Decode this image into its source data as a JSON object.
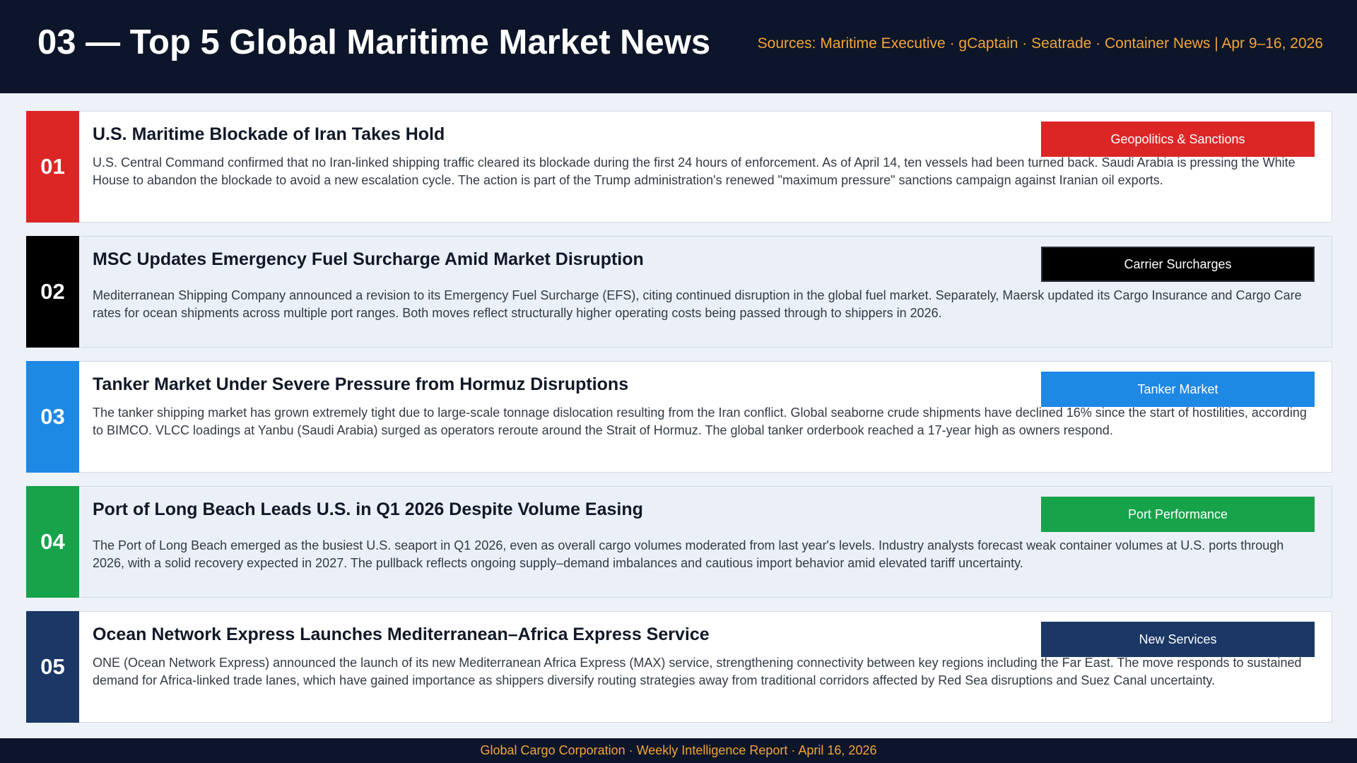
{
  "header": {
    "title": "03 — Top 5 Global Maritime Market News",
    "sources": "Sources: Maritime Executive · gCaptain · Seatrade · Container News  |  Apr 9–16, 2026"
  },
  "news": [
    {
      "number": "01",
      "title": "U.S. Maritime Blockade of Iran Takes Hold",
      "body": "U.S. Central Command confirmed that no Iran-linked shipping traffic cleared its blockade during the first 24 hours of enforcement. As of April 14, ten vessels had been turned back. Saudi Arabia is pressing the White House to abandon the blockade to avoid a new escalation cycle. The action is part of the Trump administration's renewed \"maximum pressure\" sanctions campaign against Iranian oil exports.",
      "tag": "Geopolitics & Sanctions",
      "color": "#dc2626"
    },
    {
      "number": "02",
      "title": "MSC Updates Emergency Fuel Surcharge Amid Market Disruption",
      "body": "Mediterranean Shipping Company announced a revision to its Emergency Fuel Surcharge (EFS), citing continued disruption in the global fuel market. Separately, Maersk updated its Cargo Insurance and Cargo Care rates for ocean shipments across multiple port ranges. Both moves reflect structurally higher operating costs being passed through to shippers in 2026.",
      "tag": "Carrier Surcharges",
      "color": "#000000"
    },
    {
      "number": "03",
      "title": "Tanker Market Under Severe Pressure from Hormuz Disruptions",
      "body": "The tanker shipping market has grown extremely tight due to large-scale tonnage dislocation resulting from the Iran conflict. Global seaborne crude shipments have declined 16% since the start of hostilities, according to BIMCO. VLCC loadings at Yanbu (Saudi Arabia) surged as operators reroute around the Strait of Hormuz. The global tanker orderbook reached a 17-year high as owners respond.",
      "tag": "Tanker Market",
      "color": "#1e88e5"
    },
    {
      "number": "04",
      "title": "Port of Long Beach Leads U.S. in Q1 2026 Despite Volume Easing",
      "body": "The Port of Long Beach emerged as the busiest U.S. seaport in Q1 2026, even as overall cargo volumes moderated from last year's levels. Industry analysts forecast weak container volumes at U.S. ports through 2026, with a solid recovery expected in 2027. The pullback reflects ongoing supply–demand imbalances and cautious import behavior amid elevated tariff uncertainty.",
      "tag": "Port Performance",
      "color": "#16a34a"
    },
    {
      "number": "05",
      "title": "Ocean Network Express Launches Mediterranean–Africa Express Service",
      "body": "ONE (Ocean Network Express) announced the launch of its new Mediterranean Africa Express (MAX) service, strengthening connectivity between key regions including the Far East. The move responds to sustained demand for Africa-linked trade lanes, which have gained importance as shippers diversify routing strategies away from traditional corridors affected by Red Sea disruptions and Suez Canal uncertainty.",
      "tag": "New Services",
      "color": "#1a3766"
    }
  ],
  "footer": {
    "text": "Global Cargo Corporation  ·  Weekly Intelligence Report  ·  April 16, 2026"
  }
}
